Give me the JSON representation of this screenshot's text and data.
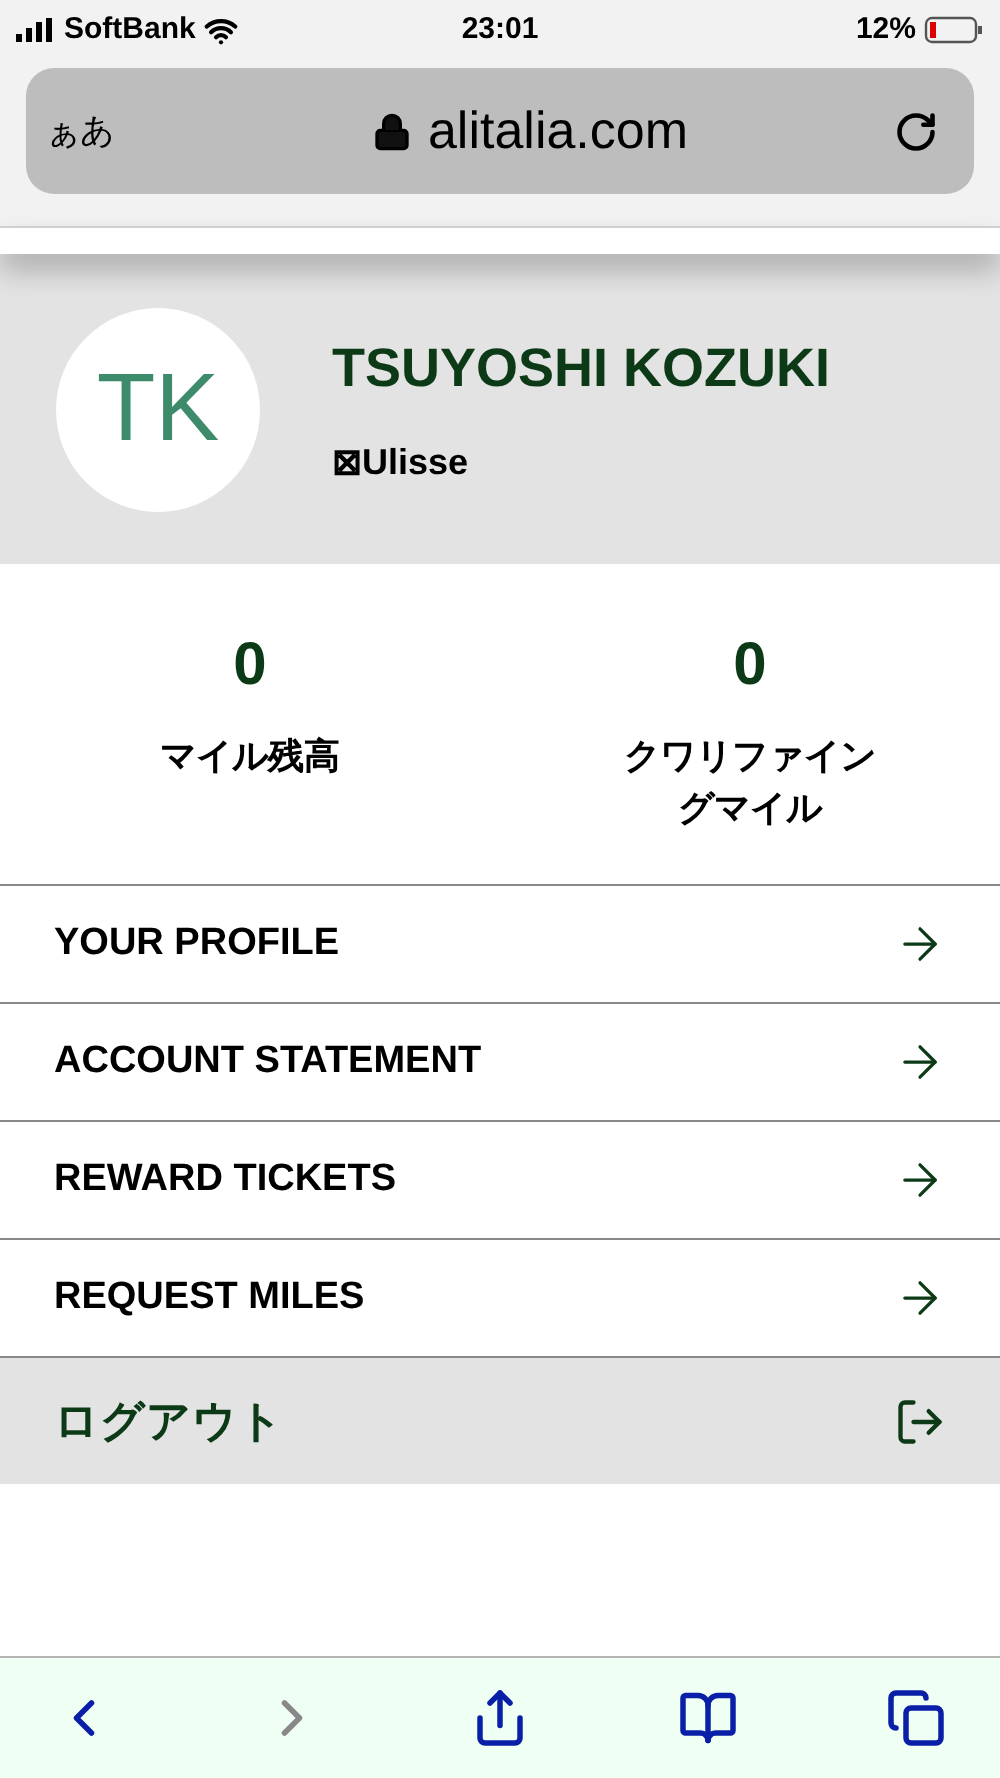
{
  "status_bar": {
    "carrier": "SoftBank",
    "time": "23:01",
    "battery": "12%"
  },
  "address_bar": {
    "text_size": "ぁあ",
    "url": "alitalia.com"
  },
  "profile": {
    "initials": "TK",
    "name": "TSUYOSHI KOZUKI",
    "tier": "⊠Ulisse"
  },
  "stats": [
    {
      "value": "0",
      "label": "マイル残高"
    },
    {
      "value": "0",
      "label": "クワリファイングマイル"
    }
  ],
  "menu": [
    {
      "kind": "link",
      "label": "YOUR PROFILE"
    },
    {
      "kind": "link",
      "label": "ACCOUNT STATEMENT"
    },
    {
      "kind": "link",
      "label": "REWARD TICKETS"
    },
    {
      "kind": "link",
      "label": "REQUEST MILES"
    },
    {
      "kind": "logout",
      "label": "ログアウト"
    }
  ],
  "toolbar": [
    {
      "kind": "back",
      "disabled": false
    },
    {
      "kind": "forward",
      "disabled": true
    },
    {
      "kind": "share",
      "disabled": false
    },
    {
      "kind": "bookmarks",
      "disabled": false
    },
    {
      "kind": "tabs",
      "disabled": false
    }
  ]
}
